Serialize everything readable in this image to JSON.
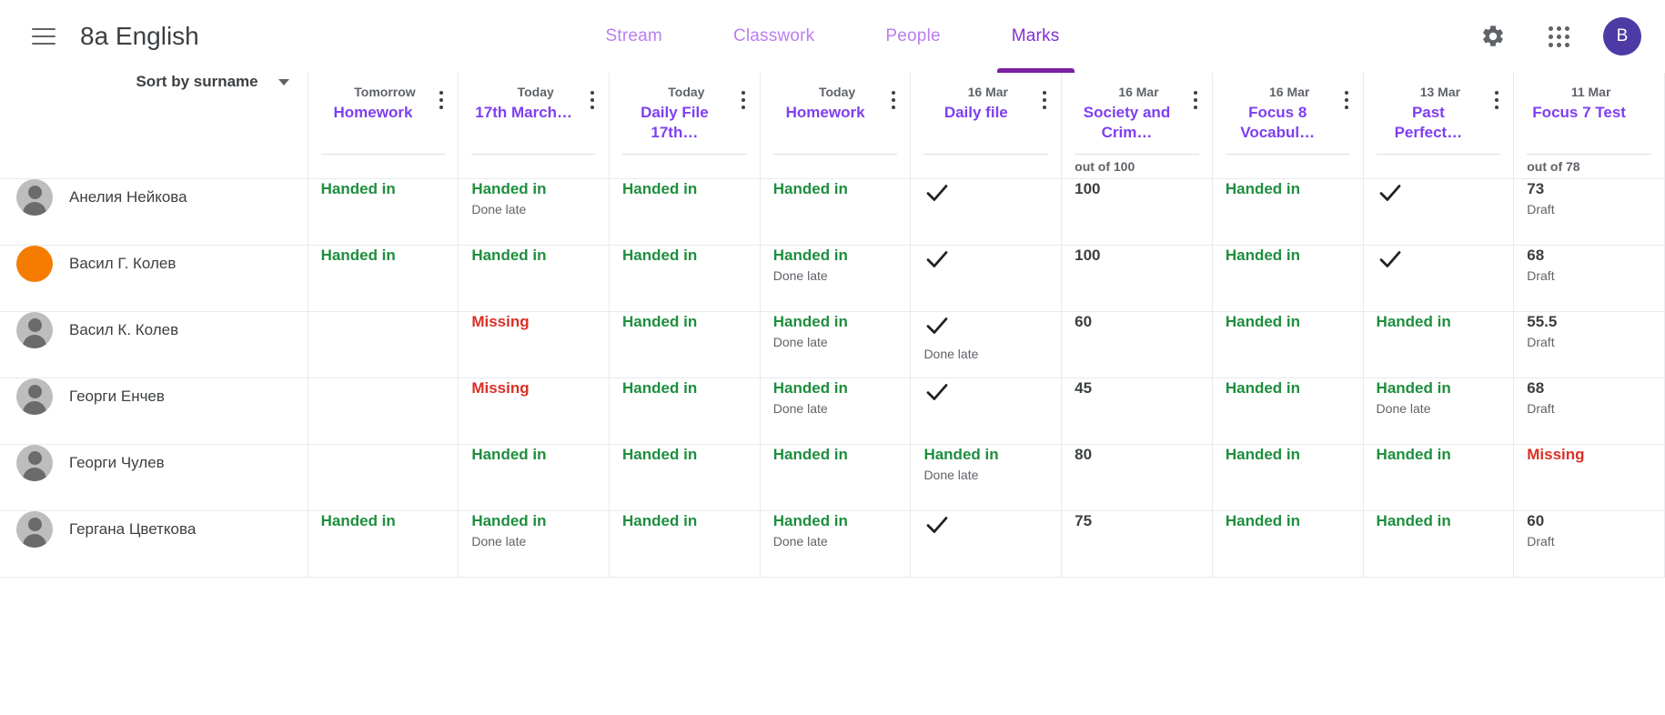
{
  "header": {
    "menu_icon": "hamburger-menu-icon",
    "class_title": "8a English",
    "tabs": [
      {
        "label": "Stream",
        "active": false
      },
      {
        "label": "Classwork",
        "active": false
      },
      {
        "label": "People",
        "active": false
      },
      {
        "label": "Marks",
        "active": true
      }
    ],
    "settings_icon": "gear-icon",
    "apps_icon": "apps-grid-icon",
    "avatar_initial": "B",
    "avatar_color": "#4d3aa5"
  },
  "toolbar": {
    "sort_label": "Sort by surname",
    "sort_caret_icon": "chevron-down-icon"
  },
  "colors": {
    "accent_purple": "#7e3ff2",
    "tab_inactive": "#bb7ef0",
    "tab_active": "#8430ce",
    "handed_in_green": "#1e8e3e",
    "missing_red": "#d93025",
    "muted_grey": "#5f6368",
    "avatar_orange": "#f57c00"
  },
  "columns": [
    {
      "due": "Tomorrow",
      "title": "Homework",
      "out_of": ""
    },
    {
      "due": "Today",
      "title": "17th March…",
      "out_of": ""
    },
    {
      "due": "Today",
      "title": "Daily File 17th…",
      "out_of": ""
    },
    {
      "due": "Today",
      "title": "Homework",
      "out_of": ""
    },
    {
      "due": "16 Mar",
      "title": "Daily file",
      "out_of": ""
    },
    {
      "due": "16 Mar",
      "title": "Society and Crim…",
      "out_of": "out of 100"
    },
    {
      "due": "16 Mar",
      "title": "Focus 8 Vocabul…",
      "out_of": ""
    },
    {
      "due": "13 Mar",
      "title": "Past Perfect…",
      "out_of": ""
    },
    {
      "due": "11 Mar",
      "title": "Focus 7 Test",
      "out_of": "out of 78"
    }
  ],
  "rows": [
    {
      "name": "Анелия Нейкова",
      "avatar": "default",
      "cells": [
        {
          "kind": "handed",
          "text": "Handed in",
          "sub": ""
        },
        {
          "kind": "handed",
          "text": "Handed in",
          "sub": "Done late"
        },
        {
          "kind": "handed",
          "text": "Handed in",
          "sub": ""
        },
        {
          "kind": "handed",
          "text": "Handed in",
          "sub": ""
        },
        {
          "kind": "check",
          "text": "",
          "sub": ""
        },
        {
          "kind": "score",
          "text": "100",
          "sub": ""
        },
        {
          "kind": "handed",
          "text": "Handed in",
          "sub": ""
        },
        {
          "kind": "check",
          "text": "",
          "sub": ""
        },
        {
          "kind": "score",
          "text": "73",
          "sub": "Draft"
        }
      ]
    },
    {
      "name": "Васил Г. Колев",
      "avatar": "orange",
      "cells": [
        {
          "kind": "handed",
          "text": "Handed in",
          "sub": ""
        },
        {
          "kind": "handed",
          "text": "Handed in",
          "sub": ""
        },
        {
          "kind": "handed",
          "text": "Handed in",
          "sub": ""
        },
        {
          "kind": "handed",
          "text": "Handed in",
          "sub": "Done late"
        },
        {
          "kind": "check",
          "text": "",
          "sub": ""
        },
        {
          "kind": "score",
          "text": "100",
          "sub": ""
        },
        {
          "kind": "handed",
          "text": "Handed in",
          "sub": ""
        },
        {
          "kind": "check",
          "text": "",
          "sub": ""
        },
        {
          "kind": "score",
          "text": "68",
          "sub": "Draft"
        }
      ]
    },
    {
      "name": "Васил К. Колев",
      "avatar": "default",
      "cells": [
        {
          "kind": "empty",
          "text": "",
          "sub": ""
        },
        {
          "kind": "missing",
          "text": "Missing",
          "sub": ""
        },
        {
          "kind": "handed",
          "text": "Handed in",
          "sub": ""
        },
        {
          "kind": "handed",
          "text": "Handed in",
          "sub": "Done late"
        },
        {
          "kind": "check",
          "text": "",
          "sub": "Done late"
        },
        {
          "kind": "score",
          "text": "60",
          "sub": ""
        },
        {
          "kind": "handed",
          "text": "Handed in",
          "sub": ""
        },
        {
          "kind": "handed",
          "text": "Handed in",
          "sub": ""
        },
        {
          "kind": "score",
          "text": "55.5",
          "sub": "Draft"
        }
      ]
    },
    {
      "name": "Георги Енчев",
      "avatar": "default",
      "cells": [
        {
          "kind": "empty",
          "text": "",
          "sub": ""
        },
        {
          "kind": "missing",
          "text": "Missing",
          "sub": ""
        },
        {
          "kind": "handed",
          "text": "Handed in",
          "sub": ""
        },
        {
          "kind": "handed",
          "text": "Handed in",
          "sub": "Done late"
        },
        {
          "kind": "check",
          "text": "",
          "sub": ""
        },
        {
          "kind": "score",
          "text": "45",
          "sub": ""
        },
        {
          "kind": "handed",
          "text": "Handed in",
          "sub": ""
        },
        {
          "kind": "handed",
          "text": "Handed in",
          "sub": "Done late"
        },
        {
          "kind": "score",
          "text": "68",
          "sub": "Draft"
        }
      ]
    },
    {
      "name": "Георги Чулев",
      "avatar": "default",
      "cells": [
        {
          "kind": "empty",
          "text": "",
          "sub": ""
        },
        {
          "kind": "handed",
          "text": "Handed in",
          "sub": ""
        },
        {
          "kind": "handed",
          "text": "Handed in",
          "sub": ""
        },
        {
          "kind": "handed",
          "text": "Handed in",
          "sub": ""
        },
        {
          "kind": "handed",
          "text": "Handed in",
          "sub": "Done late"
        },
        {
          "kind": "score",
          "text": "80",
          "sub": ""
        },
        {
          "kind": "handed",
          "text": "Handed in",
          "sub": ""
        },
        {
          "kind": "handed",
          "text": "Handed in",
          "sub": ""
        },
        {
          "kind": "missing",
          "text": "Missing",
          "sub": ""
        }
      ]
    },
    {
      "name": "Гергана Цветкова",
      "avatar": "default",
      "cells": [
        {
          "kind": "handed",
          "text": "Handed in",
          "sub": ""
        },
        {
          "kind": "handed",
          "text": "Handed in",
          "sub": "Done late"
        },
        {
          "kind": "handed",
          "text": "Handed in",
          "sub": ""
        },
        {
          "kind": "handed",
          "text": "Handed in",
          "sub": "Done late"
        },
        {
          "kind": "check",
          "text": "",
          "sub": ""
        },
        {
          "kind": "score",
          "text": "75",
          "sub": ""
        },
        {
          "kind": "handed",
          "text": "Handed in",
          "sub": ""
        },
        {
          "kind": "handed",
          "text": "Handed in",
          "sub": ""
        },
        {
          "kind": "score",
          "text": "60",
          "sub": "Draft"
        }
      ]
    }
  ]
}
